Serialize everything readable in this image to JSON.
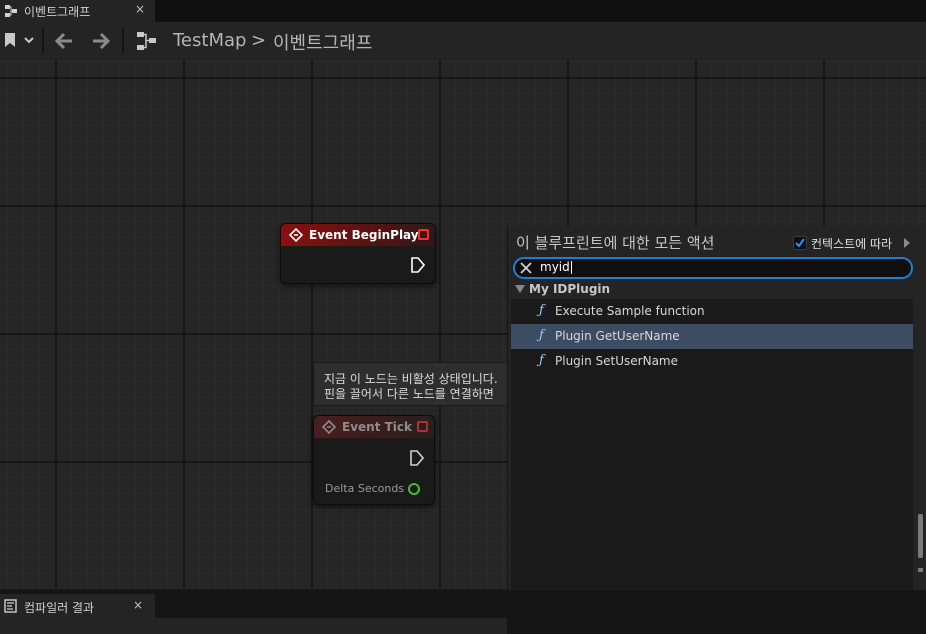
{
  "doc_tab": {
    "label": "이벤트그래프",
    "close": "×",
    "icon": "graph-icon"
  },
  "toolbar": {
    "bookmark_icon": "bookmark-icon",
    "back_icon": "arrow-left-icon",
    "forward_icon": "arrow-right-icon",
    "breadcrumb": {
      "level1": "TestMap",
      "separator": ">",
      "level2": "이벤트그래프"
    }
  },
  "nodes": {
    "begin_play": {
      "title": "Event BeginPlay",
      "color": "#8a1010"
    },
    "tick": {
      "title": "Event Tick",
      "pin_label": "Delta Seconds",
      "pin_color": "#3fbf2a"
    }
  },
  "tooltip": {
    "line1": "지금 이 노드는 비활성 상태입니다.",
    "line2": "핀을 끌어서 다른 노드를 연결하면"
  },
  "action_menu": {
    "title": "이 블루프린트에 대한 모든 액션",
    "context_label": "컨텍스트에 따라",
    "context_checked": true,
    "search_value": "myid",
    "category": "My IDPlugin",
    "items": [
      {
        "label": "Execute Sample function",
        "selected": false
      },
      {
        "label": "Plugin GetUserName",
        "selected": true
      },
      {
        "label": "Plugin SetUserName",
        "selected": false
      }
    ],
    "function_glyph": "ƒ",
    "accent": "#1d7fd1",
    "selection_color": "#3c4c62"
  },
  "bottom_tab": {
    "label": "컴파일러 결과",
    "close": "×"
  }
}
